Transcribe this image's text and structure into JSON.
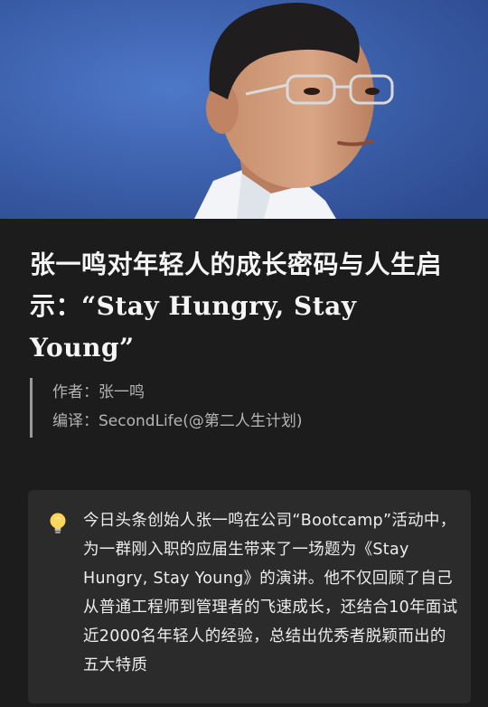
{
  "hero": {
    "image_icon": "speaker-portrait-photo"
  },
  "article": {
    "title": "张一鸣对年轻人的成长密码与人生启示：“Stay Hungry, Stay Young”",
    "author_line": "作者：张一鸣",
    "translator_line": "编译：SecondLife(@第二人生计划)"
  },
  "callout": {
    "icon": "lightbulb-icon",
    "text": "今日头条创始人张一鸣在公司“Bootcamp”活动中，为一群刚入职的应届生带来了一场题为《Stay Hungry, Stay Young》的演讲。他不仅回顾了自己从普通工程师到管理者的飞速成长，还结合10年面试近2000名年轻人的经验，总结出优秀者脱颖而出的五大特质"
  },
  "colors": {
    "page_background": "#1c1c1c",
    "callout_background": "#2b2b2b",
    "hero_background": "#3e66b6",
    "meta_text": "#b4b4b4",
    "meta_border": "#9a9a9a"
  }
}
